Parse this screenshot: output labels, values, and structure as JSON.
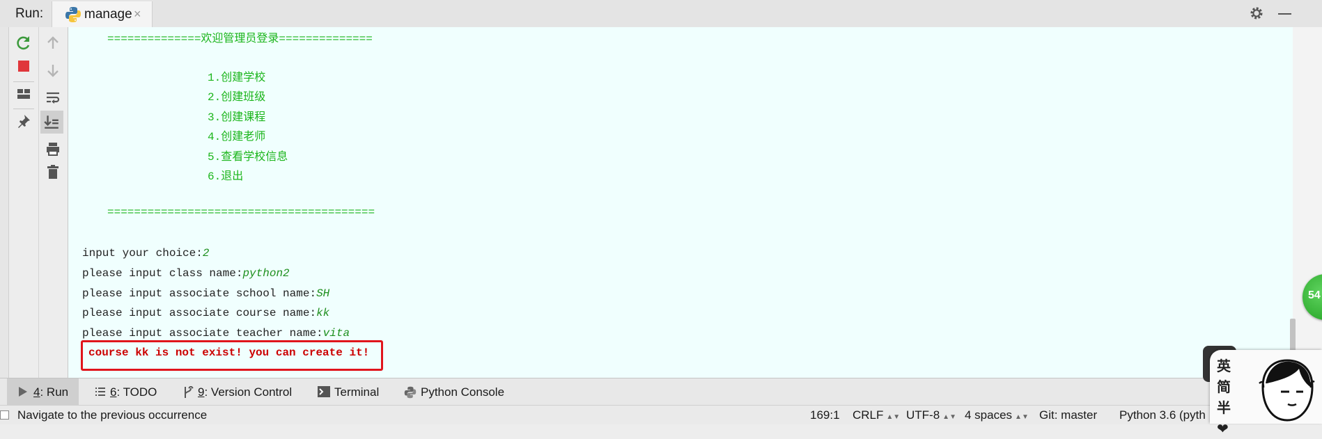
{
  "run_panel": {
    "label": "Run:",
    "tab": {
      "label": "manage",
      "close": "×"
    }
  },
  "toolbar": {
    "icons": [
      "rerun-icon",
      "stop-icon",
      "layout-icon",
      "pin-icon",
      "up-arrow-icon",
      "down-arrow-icon",
      "soft-wrap-icon",
      "scroll-to-end-icon",
      "print-icon",
      "trash-icon"
    ]
  },
  "console": {
    "menu_header": "==============欢迎管理员登录==============",
    "menu_items": [
      "1.创建学校",
      "2.创建班级",
      "3.创建课程",
      "4.创建老师",
      "5.查看学校信息",
      "6.退出"
    ],
    "menu_footer": "========================================",
    "prompts": [
      {
        "prompt": "input your choice:",
        "input": "2"
      },
      {
        "prompt": "please input class name:",
        "input": "python2"
      },
      {
        "prompt": "please input associate school name:",
        "input": "SH"
      },
      {
        "prompt": "please input associate course name:",
        "input": "kk"
      },
      {
        "prompt": "please input associate teacher name:",
        "input": "vita"
      }
    ],
    "error": "course kk is not exist! you can create it!"
  },
  "bottom_tabs": [
    {
      "num": "4",
      "label": ": Run"
    },
    {
      "num": "6",
      "label": ": TODO"
    },
    {
      "num": "9",
      "label": ": Version Control"
    },
    {
      "num": "",
      "label": "Terminal"
    },
    {
      "num": "",
      "label": "Python Console"
    }
  ],
  "status_bar": {
    "message": "Navigate to the previous occurrence",
    "position": "169:1",
    "line_sep": "CRLF",
    "encoding": "UTF-8",
    "indent": "4 spaces",
    "git": "Git: master",
    "interpreter": "Python 3.6 (pyth"
  },
  "widgets": {
    "badge": "54",
    "mascot_text": [
      "英",
      "简",
      "半",
      "❤"
    ]
  },
  "colors": {
    "console_bg": "#f0fffe",
    "menu_text": "#1bb51b",
    "error_text": "#cc0000",
    "highlight_border": "#e0151c"
  }
}
